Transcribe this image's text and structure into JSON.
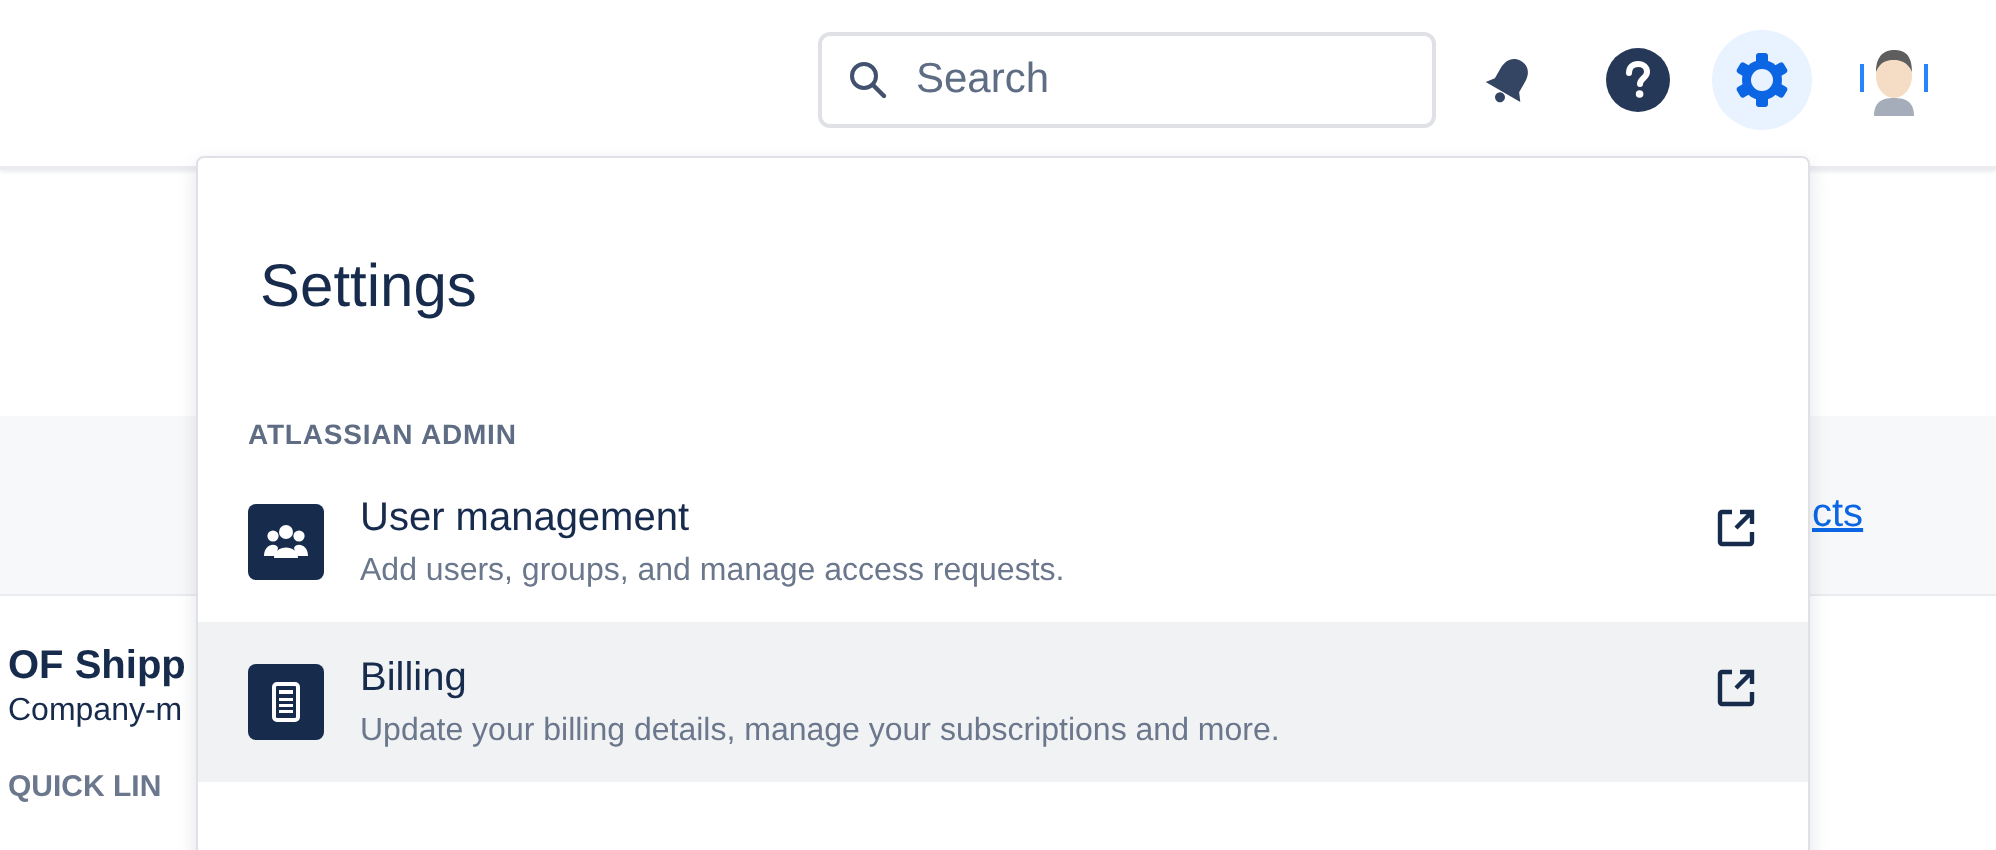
{
  "header": {
    "search": {
      "placeholder": "Search"
    },
    "settings_active": true
  },
  "background": {
    "banner_link": "cts",
    "project": {
      "title": "OF Shipp",
      "subtitle": "Company-m",
      "section": "QUICK LIN"
    }
  },
  "settings_menu": {
    "title": "Settings",
    "sections": [
      {
        "heading": "ATLASSIAN ADMIN",
        "items": [
          {
            "kind": "users",
            "title": "User management",
            "description": "Add users, groups, and manage access requests.",
            "selected": false
          },
          {
            "kind": "billing",
            "title": "Billing",
            "description": "Update your billing details, manage your subscriptions and more.",
            "selected": true
          }
        ]
      }
    ]
  }
}
